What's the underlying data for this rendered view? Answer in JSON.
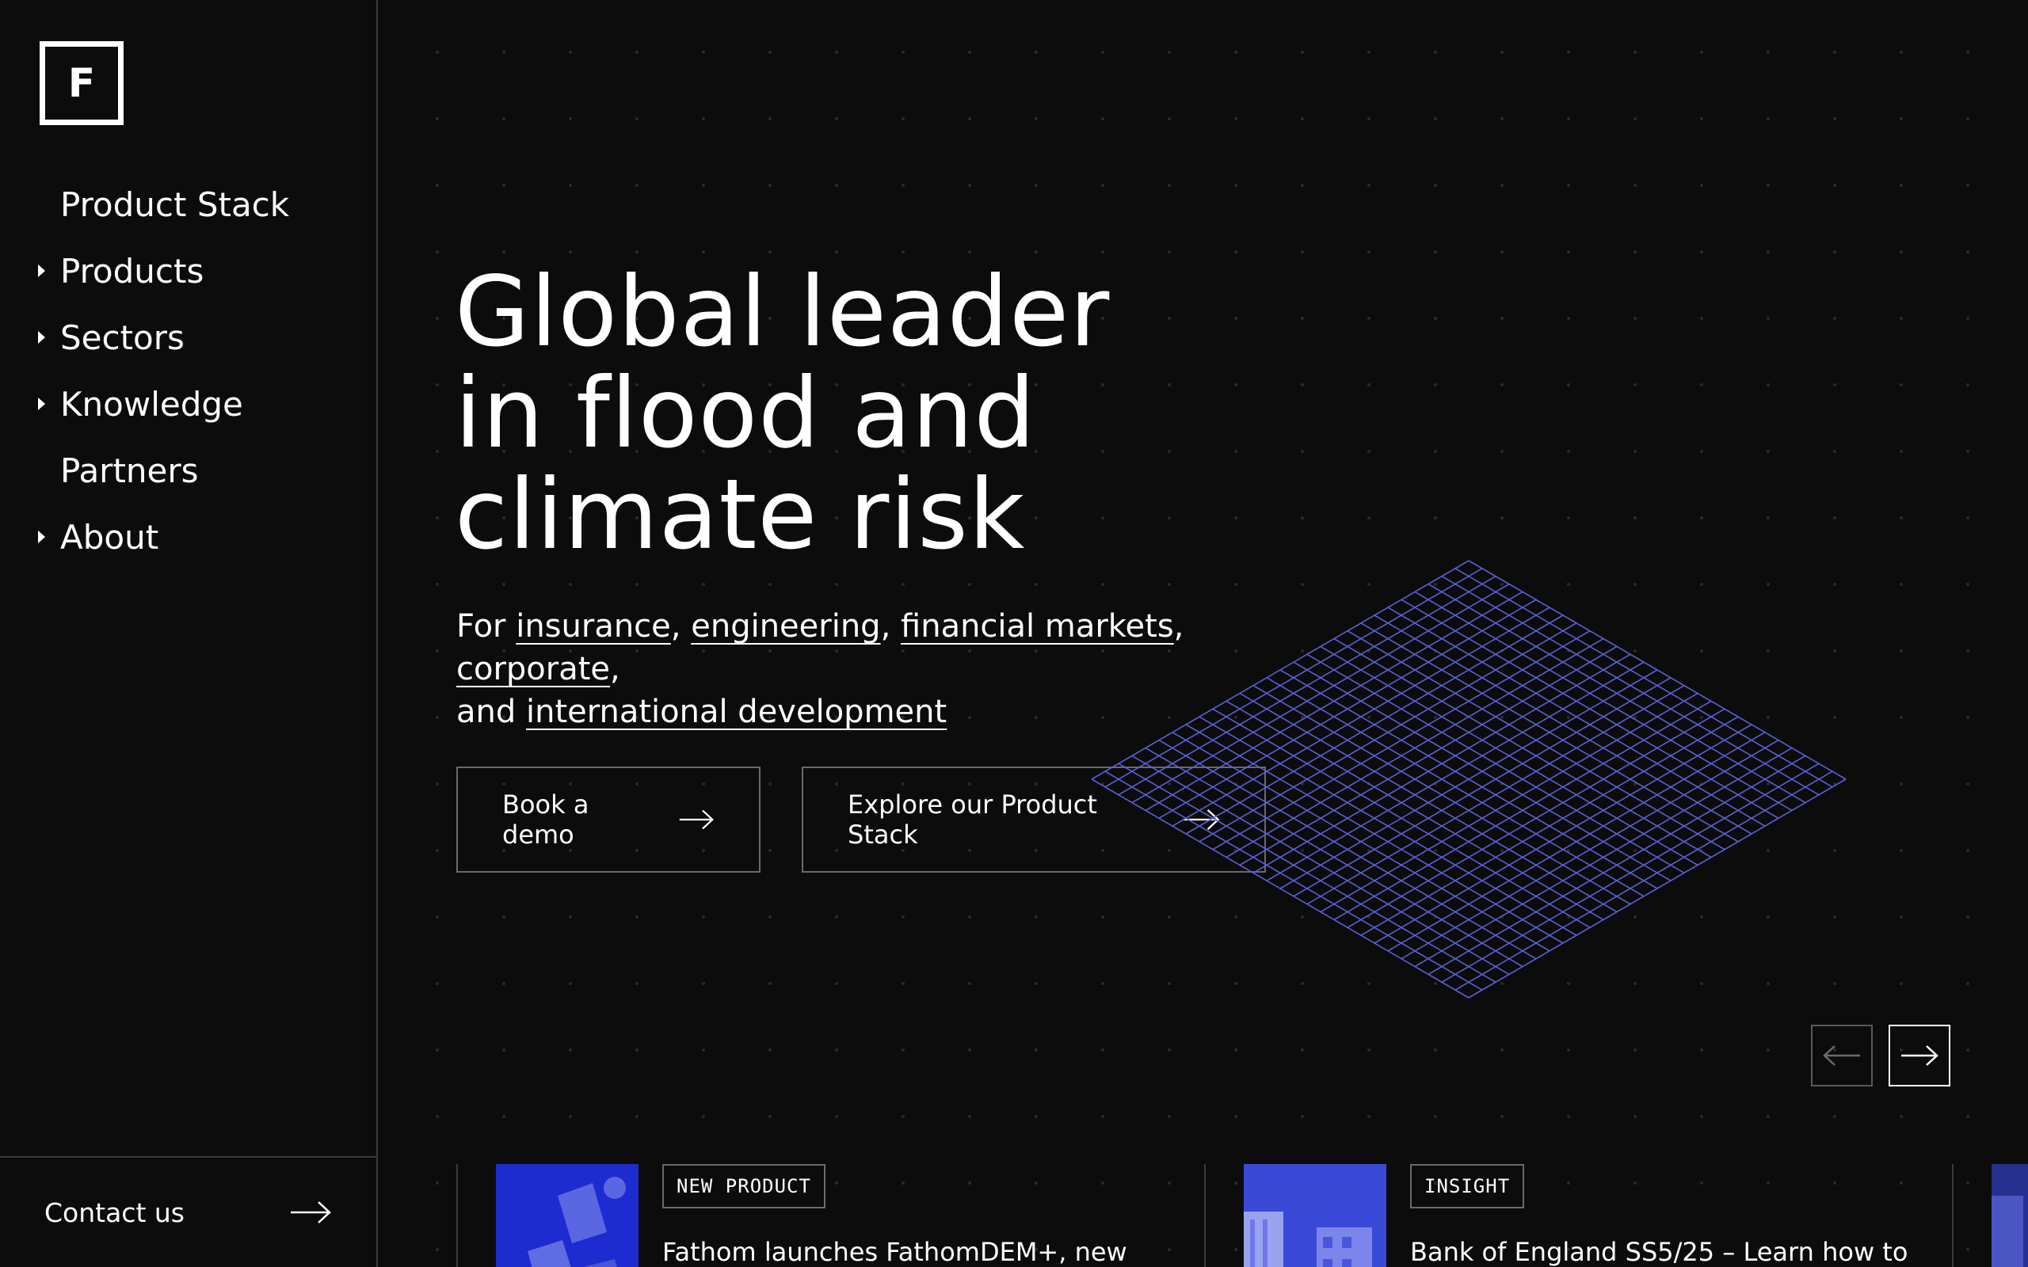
{
  "logo": {
    "letter": "F"
  },
  "sidebar": {
    "items": [
      {
        "label": "Product Stack",
        "has_children": false
      },
      {
        "label": "Products",
        "has_children": true
      },
      {
        "label": "Sectors",
        "has_children": true
      },
      {
        "label": "Knowledge",
        "has_children": true
      },
      {
        "label": "Partners",
        "has_children": false
      },
      {
        "label": "About",
        "has_children": true
      }
    ],
    "contact_label": "Contact us"
  },
  "hero": {
    "title_line1": "Global leader",
    "title_line2": "in flood and",
    "title_line3": "climate risk",
    "sub_prefix": "For",
    "sub_links": [
      "insurance",
      "engineering",
      "financial markets",
      "corporate"
    ],
    "sub_and": "and",
    "sub_last": "international development"
  },
  "buttons": {
    "demo": "Book a demo",
    "explore": "Explore our Product Stack"
  },
  "news": [
    {
      "tag": "NEW PRODUCT",
      "title": "Fathom launches FathomDEM+, new"
    },
    {
      "tag": "INSIGHT",
      "title": "Bank of England SS5/25 – Learn how to"
    }
  ],
  "colors": {
    "background": "#0c0c0d",
    "accent_blue": "#1f2fd6",
    "grid_line": "#5c5fd4",
    "border": "#3a3a3d"
  }
}
